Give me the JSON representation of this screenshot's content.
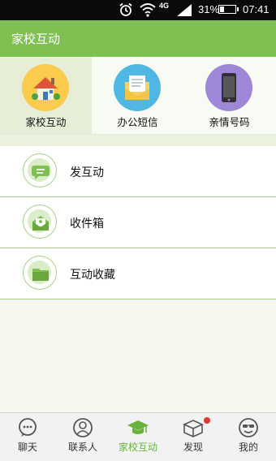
{
  "status_bar": {
    "network": "4G",
    "battery": "31%",
    "battery_level": 0.31,
    "time": "07:41"
  },
  "header": {
    "title": "家校互动"
  },
  "categories": [
    {
      "label": "家校互动",
      "icon": "house-icon",
      "color": "#fbcb4e",
      "active": true
    },
    {
      "label": "办公短信",
      "icon": "envelope-icon",
      "color": "#4fb7e3",
      "active": false
    },
    {
      "label": "亲情号码",
      "icon": "phone-icon",
      "color": "#9e86d8",
      "active": false
    }
  ],
  "list": [
    {
      "label": "发互动",
      "icon": "chat-bubble-icon"
    },
    {
      "label": "收件箱",
      "icon": "inbox-icon"
    },
    {
      "label": "互动收藏",
      "icon": "folder-icon"
    }
  ],
  "bottom_nav": [
    {
      "label": "聊天",
      "icon": "chat-icon",
      "active": false
    },
    {
      "label": "联系人",
      "icon": "contact-icon",
      "active": false
    },
    {
      "label": "家校互动",
      "icon": "graduation-cap-icon",
      "active": true
    },
    {
      "label": "发现",
      "icon": "discover-box-icon",
      "active": false,
      "badge": true
    },
    {
      "label": "我的",
      "icon": "profile-face-icon",
      "active": false
    }
  ],
  "colors": {
    "accent": "#7ec051",
    "active_nav": "#6ab23c",
    "badge": "#e9342f"
  }
}
